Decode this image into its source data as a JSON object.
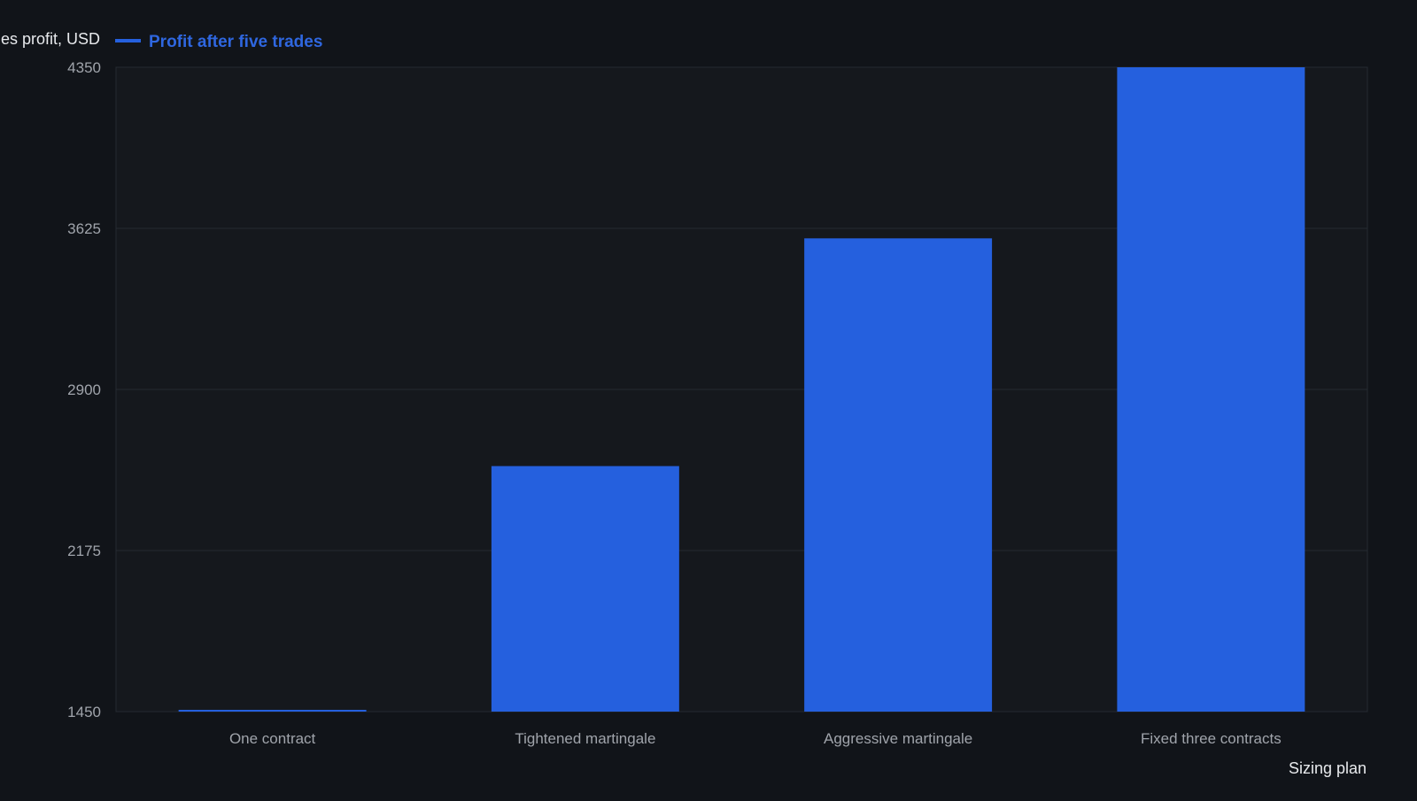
{
  "colors": {
    "background": "#111419",
    "plot_background": "#15181d",
    "bar": "#2560de",
    "legend_text": "#2f67e0",
    "grid": "#252a31",
    "axis_tick_text": "#a0a4ab",
    "axis_title_text": "#e8eaed"
  },
  "chart_data": {
    "type": "bar",
    "title": "",
    "xlabel": "Sizing plan",
    "ylabel": "es profit, USD",
    "categories": [
      "One contract",
      "Tightened martingale",
      "Aggressive martingale",
      "Fixed three contracts"
    ],
    "series": [
      {
        "name": "Profit after five trades",
        "values": [
          1455,
          2555,
          3580,
          4350
        ]
      }
    ],
    "ylim": [
      1450,
      4350
    ],
    "yticks": [
      "4350",
      "3625",
      "2900",
      "2175",
      "1450"
    ],
    "grid": true,
    "legend_position": "top-left"
  }
}
